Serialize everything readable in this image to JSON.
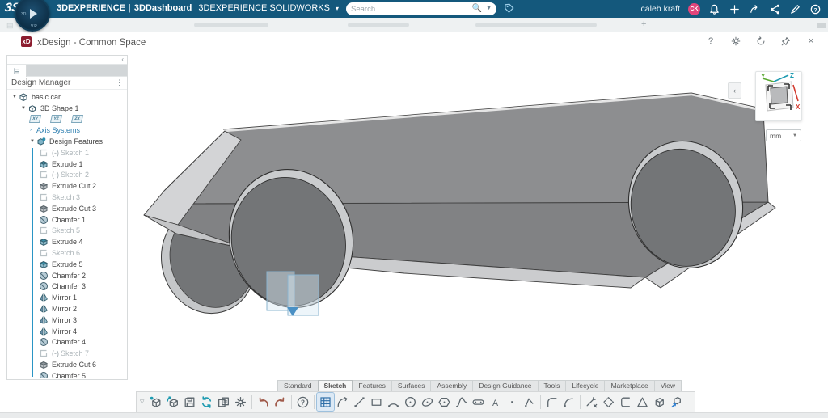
{
  "topbar": {
    "brand_bold": "3DEXPERIENCE",
    "brand_sep": "|",
    "brand_app": "3DDashboard",
    "brand_platform": "3DEXPERIENCE SOLIDWORKS",
    "brand_caret": "v",
    "search_placeholder": "Search",
    "user_name": "caleb kraft",
    "avatar_initials": "CK",
    "icons": [
      "bell-icon",
      "plus-icon",
      "share-forward-icon",
      "share-network-icon",
      "pen-icon",
      "help-circle-icon"
    ]
  },
  "dashboard_strip": {
    "placeholder_tab_count": 3,
    "new_tab_label": "+"
  },
  "title_row": {
    "app_badge": "xD",
    "app_title": "xDesign - Common Space",
    "window_controls": [
      "help",
      "settings",
      "refresh",
      "pin",
      "close"
    ],
    "help_glyph": "?",
    "close_glyph": "×"
  },
  "panel": {
    "header": "Design Manager",
    "menu_glyph": "⋮",
    "collapse_glyph": "‹",
    "planes": [
      "XY",
      "YZ",
      "ZX"
    ],
    "tree": [
      {
        "caret": "▼",
        "icon": "cube",
        "label": "basic car",
        "level": 0
      },
      {
        "caret": "▼",
        "icon": "shape",
        "label": "3D Shape 1",
        "level": 1
      },
      {
        "type": "planes",
        "level": 2
      },
      {
        "caret": "›",
        "icon": null,
        "label": "Axis Systems",
        "level": 2,
        "blue": true
      },
      {
        "caret": "▼",
        "icon": "feat",
        "label": "Design Features",
        "level": 2
      },
      {
        "icon": "sk",
        "prefix": "(-)",
        "label": "Sketch 1",
        "level": 3,
        "muted": true
      },
      {
        "icon": "ext",
        "label": "Extrude 1",
        "level": 3
      },
      {
        "icon": "sk",
        "prefix": "(-)",
        "label": "Sketch 2",
        "level": 3,
        "muted": true
      },
      {
        "icon": "cut",
        "label": "Extrude Cut 2",
        "level": 3
      },
      {
        "icon": "sk",
        "label": "Sketch 3",
        "level": 3,
        "muted": true
      },
      {
        "icon": "cut",
        "label": "Extrude Cut 3",
        "level": 3
      },
      {
        "icon": "cham",
        "label": "Chamfer 1",
        "level": 3
      },
      {
        "icon": "sk",
        "label": "Sketch 5",
        "level": 3,
        "muted": true
      },
      {
        "icon": "ext",
        "label": "Extrude 4",
        "level": 3
      },
      {
        "icon": "sk",
        "label": "Sketch 6",
        "level": 3,
        "muted": true
      },
      {
        "icon": "ext",
        "label": "Extrude 5",
        "level": 3
      },
      {
        "icon": "cham",
        "label": "Chamfer 2",
        "level": 3
      },
      {
        "icon": "cham",
        "label": "Chamfer 3",
        "level": 3
      },
      {
        "icon": "mir",
        "label": "Mirror 1",
        "level": 3
      },
      {
        "icon": "mir",
        "label": "Mirror 2",
        "level": 3
      },
      {
        "icon": "mir",
        "label": "Mirror 3",
        "level": 3
      },
      {
        "icon": "mir",
        "label": "Mirror 4",
        "level": 3
      },
      {
        "icon": "cham",
        "label": "Chamfer 4",
        "level": 3
      },
      {
        "icon": "sk",
        "prefix": "(-)",
        "label": "Sketch 7",
        "level": 3,
        "muted": true
      },
      {
        "icon": "cut",
        "label": "Extrude Cut 6",
        "level": 3
      },
      {
        "icon": "cham",
        "label": "Chamfer 5",
        "level": 3
      }
    ]
  },
  "viewport": {
    "units_value": "mm",
    "axis_labels": {
      "x": "X",
      "y": "Y",
      "z": "Z"
    },
    "collapse_glyph": "‹"
  },
  "ribbon": {
    "tabs": [
      "Standard",
      "Sketch",
      "Features",
      "Surfaces",
      "Assembly",
      "Design Guidance",
      "Tools",
      "Lifecycle",
      "Marketplace",
      "View"
    ],
    "active_tab": "Sketch",
    "tools": [
      {
        "name": "new-shape-tool",
        "icon": "cube_new"
      },
      {
        "name": "open-shape-tool",
        "icon": "cube_open"
      },
      {
        "name": "save-tool",
        "icon": "save"
      },
      {
        "name": "sync-tool",
        "icon": "sync"
      },
      {
        "name": "transfer-tool",
        "icon": "transfer"
      },
      {
        "name": "settings-tool",
        "icon": "gear"
      },
      {
        "sep": true
      },
      {
        "name": "undo-tool",
        "icon": "undo"
      },
      {
        "name": "redo-tool",
        "icon": "redo"
      },
      {
        "sep": true
      },
      {
        "name": "help-tool",
        "icon": "help"
      },
      {
        "sep": true
      },
      {
        "name": "sketch-tool",
        "icon": "grid",
        "active": true
      },
      {
        "name": "smart-sketch-tool",
        "icon": "smart"
      },
      {
        "name": "line-tool",
        "icon": "line"
      },
      {
        "name": "rectangle-tool",
        "icon": "rect"
      },
      {
        "name": "arc-tool",
        "icon": "arc"
      },
      {
        "name": "circle-tool",
        "icon": "circle"
      },
      {
        "name": "ellipse-tool",
        "icon": "ellipse"
      },
      {
        "name": "polygon-tool",
        "icon": "polygon"
      },
      {
        "name": "spline-tool",
        "icon": "spline"
      },
      {
        "name": "slot-tool",
        "icon": "slot"
      },
      {
        "name": "text-tool",
        "icon": "text"
      },
      {
        "name": "point-tool",
        "icon": "point"
      },
      {
        "name": "polyline-tool",
        "icon": "polyline"
      },
      {
        "sep": true
      },
      {
        "name": "fillet-tool",
        "icon": "fillet"
      },
      {
        "name": "corner-arc-tool",
        "icon": "cornerarc"
      },
      {
        "sep": true
      },
      {
        "name": "trim-tool",
        "icon": "trim"
      },
      {
        "name": "offset-tool",
        "icon": "offset"
      },
      {
        "name": "offset-entities-tool",
        "icon": "offsetc"
      },
      {
        "name": "convert-tool",
        "icon": "convert"
      },
      {
        "name": "box-tool",
        "icon": "box"
      },
      {
        "name": "project-tool",
        "icon": "project"
      }
    ]
  },
  "colors": {
    "topbar_bg": "#14587c",
    "avatar_pink": "#e0457b",
    "tree_scope_blue": "#2a95c5",
    "axis_x_red": "#d23b2f",
    "axis_y_green": "#5aa832",
    "axis_z_teal": "#1d9ab0",
    "active_tool_blue": "#2f6fa8",
    "selection_blue": "#8ab4cf",
    "body_gray_top": "#8d8e90",
    "body_gray_side": "#818284",
    "body_gray_light": "#d3d4d6",
    "wheel_dark": "#737577",
    "wheel_rim": "#caccce"
  }
}
